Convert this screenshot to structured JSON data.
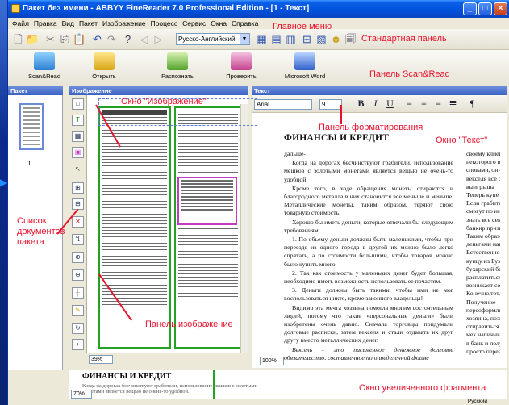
{
  "window": {
    "title": "Пакет без имени - ABBYY FineReader 7.0 Professional Edition - [1 - Текст]"
  },
  "menu": [
    "Файл",
    "Правка",
    "Вид",
    "Пакет",
    "Изображение",
    "Процесс",
    "Сервис",
    "Окна",
    "Справка"
  ],
  "toolbar": {
    "language": "Русско-Английский"
  },
  "scanread": {
    "buttons": [
      "Scan&Read",
      "Открыть",
      "Распознать",
      "Проверить",
      "Microsoft Word"
    ]
  },
  "panels": {
    "packet": "Пакет",
    "image": "Изображение",
    "text": "Текст"
  },
  "thumbnail": {
    "number": "1"
  },
  "format": {
    "font": "Arial",
    "size": "9"
  },
  "zoom": {
    "image": "39%",
    "text": "100%",
    "zoomwin": "70%"
  },
  "document": {
    "title": "ФИНАНСЫ И КРЕДИТ",
    "col1": [
      "дальше-",
      "Когда на дорогах бесчинствуют грабители, использование мешков с золотыми монетами является вещью не очень-то удобной.",
      "Кроме того, в ходе обращения монеты стираются и благородного металла в них становится все меньше и меньше. Металлические монеты, таким образом, теряют свою товарную стоимость.",
      "Хорошо бы иметь деньги, которые отвечали бы следующим требованиям.",
      "1. По обьему деньги должны быть маленькими, чтобы при переезде из одного города в другой их можно было легко спрятать, а по стоимости большими, чтобы товаров можно было купить много.",
      "2. Так как стоимость у маленьких денег будет большая, необходимо иметь возможность использовать ее почастям.",
      "3. Деньги должны быть такими, чтобы ими не мог воспользоваться никто, кроме законного владельца!",
      "Видимо эта мечта хозяина помогла многим состоятельным людей, потому что такие «персональные деньги» были изобретены очень давно. Сначала торговцы придумали долговые расписки, затем векселя и стали отдавать их друг другу вместо металлических денег.",
      "Вексель - это письменное денежное долговое обязательство, составленное по определенной форме"
    ],
    "col2": [
      "своему клиенту",
      "некоторого вс",
      "словами, он с",
      "векселя все с",
      "выигрыша",
      "Теперь купе",
      "Если грабител",
      "смогут по ним",
      "знать все сек",
      "банкир призна",
      "Таким образом",
      "деньгами нашел",
      "Естественно",
      "купцу из Бухар",
      "бухарский банк",
      "расплатиться в",
      "возникает сомн",
      "Конечно,тот, кто",
      "Получение",
      "переоформлени",
      "хозяина, позв",
      "отправиться в г",
      "мех напичные д",
      "в банк и получ",
      "просто перевес"
    ]
  },
  "zoomwindow": {
    "title": "ФИНАНСЫ И КРЕДИТ",
    "line1": "Когда на дорогах бесчинствуют грабители, использование мешков с золотыми монетами является вещью не очень-то удобной."
  },
  "status": {
    "language": "Русский"
  },
  "annotations": {
    "main_menu": "Главное меню",
    "standard_panel": "Стандартная панель",
    "scanread_panel": "Панель Scan&Read",
    "image_window": "Окно \"Изображение\"",
    "format_panel": "Панель форматирования",
    "text_window": "Окно \"Текст\"",
    "packet_list": "Список\nдокументов\nпакета",
    "image_panel": "Панель изображение",
    "zoom_window": "Окно увеличенного фрагмента"
  },
  "colors": {
    "annotation": "#e8122d",
    "titlebar": "#0151dc",
    "block_text": "#24a124",
    "block_picture": "#c03cc0"
  }
}
